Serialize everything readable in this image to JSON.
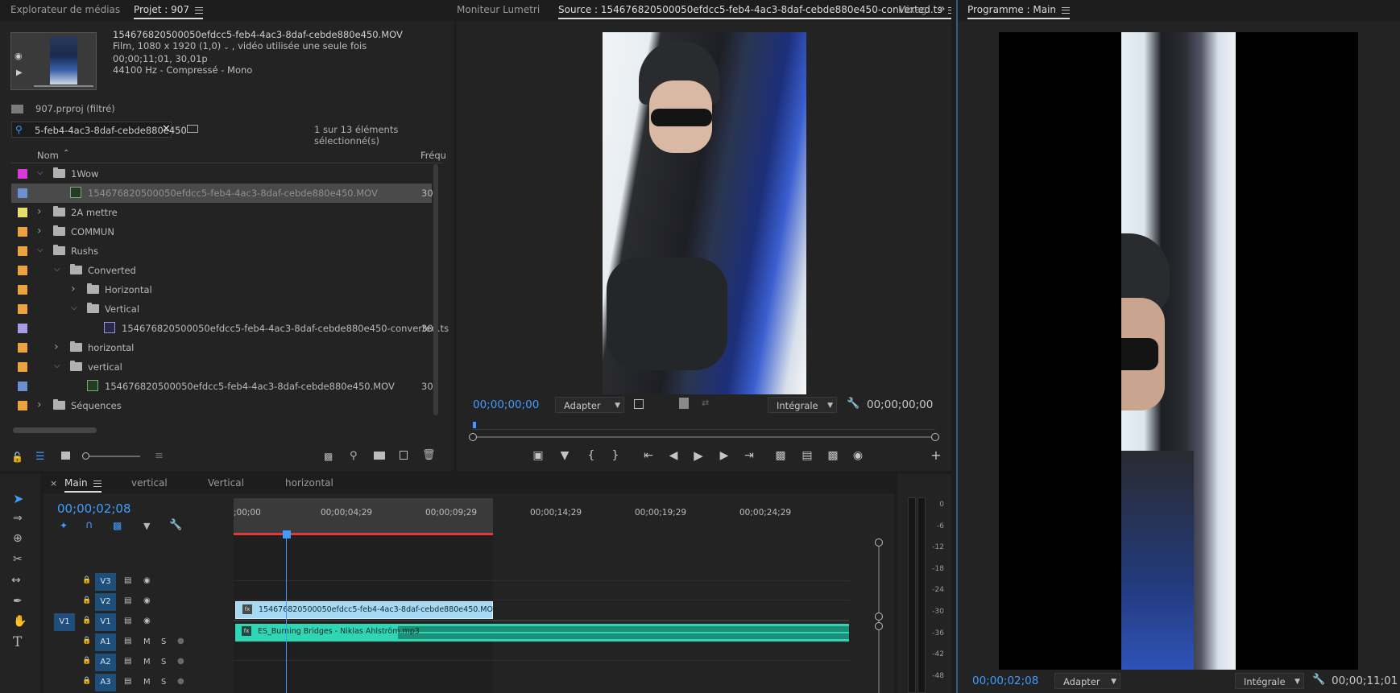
{
  "project_panel": {
    "tabs": [
      "Explorateur de médias",
      "Projet : 907"
    ],
    "clip_info": {
      "name": "154676820500050efdcc5-feb4-4ac3-8daf-cebde880e450.MOV",
      "line2": "Film, 1080 x 1920 (1,0)",
      "line2_suffix": ", vidéo utilisée une seule fois",
      "line3": "00;00;11;01, 30,01p",
      "line4": "44100 Hz - Compressé - Mono"
    },
    "project_file": "907.prproj (filtré)",
    "search_value": "5-feb4-4ac3-8daf-cebde880e450",
    "selection_count": "1 sur 13 éléments sélectionné(s)",
    "col_name": "Nom",
    "col_rate": "Fréqu",
    "rows": [
      {
        "name": "1Wow",
        "type": "folder",
        "expanded": true,
        "color": "#d63ad6",
        "rate": ""
      },
      {
        "name": "154676820500050efdcc5-feb4-4ac3-8daf-cebde880e450.MOV",
        "type": "sequence",
        "color": "#6b8fd0",
        "rate": "30,"
      },
      {
        "name": "2A mettre",
        "type": "folder",
        "expanded": false,
        "color": "#e6e06a",
        "rate": ""
      },
      {
        "name": "COMMUN",
        "type": "folder",
        "expanded": false,
        "color": "#eba240",
        "rate": ""
      },
      {
        "name": "Rushs",
        "type": "folder",
        "expanded": true,
        "color": "#eba240",
        "rate": ""
      },
      {
        "name": "Converted",
        "type": "folder",
        "expanded": true,
        "color": "#eba240",
        "rate": ""
      },
      {
        "name": "Horizontal",
        "type": "folder",
        "expanded": false,
        "color": "#eba240",
        "rate": ""
      },
      {
        "name": "Vertical",
        "type": "folder",
        "expanded": true,
        "color": "#eba240",
        "rate": ""
      },
      {
        "name": "154676820500050efdcc5-feb4-4ac3-8daf-cebde880e450-converted.ts",
        "type": "clip",
        "color": "#a89ae6",
        "rate": "30,"
      },
      {
        "name": "horizontal",
        "type": "folder",
        "expanded": false,
        "color": "#eba240",
        "rate": ""
      },
      {
        "name": "vertical",
        "type": "folder",
        "expanded": true,
        "color": "#eba240",
        "rate": ""
      },
      {
        "name": "154676820500050efdcc5-feb4-4ac3-8daf-cebde880e450.MOV",
        "type": "sequence",
        "color": "#6b8fd0",
        "rate": "30,"
      },
      {
        "name": "Séquences",
        "type": "folder",
        "expanded": false,
        "color": "#eba240",
        "rate": ""
      }
    ]
  },
  "source_panel": {
    "tabs": [
      "Moniteur Lumetri",
      "Source : 154676820500050efdcc5-feb4-4ac3-8daf-cebde880e450-converted.ts",
      "Mixag"
    ],
    "timecode_left": "00;00;00;00",
    "zoom": "Adapter",
    "quality": "Intégrale",
    "timecode_right": "00;00;00;00",
    "playhead_fraction": 0
  },
  "program_panel": {
    "title": "Programme : Main",
    "timecode_left": "00;00;02;08",
    "zoom": "Adapter",
    "quality": "Intégrale",
    "timecode_right": "00;00;11;01"
  },
  "timeline": {
    "tabs": [
      "Main",
      "vertical",
      "Vertical",
      "horizontal"
    ],
    "current_time": "00;00;02;08",
    "ruler_labels": [
      ";00;00",
      "00;00;04;29",
      "00;00;09;29",
      "00;00;14;29",
      "00;00;19;29",
      "00;00;24;29"
    ],
    "tracks": [
      {
        "name": "V3",
        "kind": "video"
      },
      {
        "name": "V2",
        "kind": "video"
      },
      {
        "name": "V1",
        "kind": "video",
        "source": "V1"
      },
      {
        "name": "A1",
        "kind": "audio",
        "mute": "M",
        "solo": "S"
      },
      {
        "name": "A2",
        "kind": "audio",
        "mute": "M",
        "solo": "S"
      },
      {
        "name": "A3",
        "kind": "audio",
        "mute": "M",
        "solo": "S"
      }
    ],
    "clips": {
      "video": "154676820500050efdcc5-feb4-4ac3-8daf-cebde880e450.MOV",
      "audio": "ES_Burning Bridges - Niklas Ahlström.mp3"
    }
  },
  "audio_meter": {
    "labels": [
      "0",
      "-6",
      "-12",
      "-18",
      "-24",
      "-30",
      "-36",
      "-42",
      "-48"
    ]
  },
  "colors": {
    "accent_blue": "#3f9cff",
    "video_clip": "#a5d8f3",
    "audio_clip": "#2fd6b4",
    "work_area": "#e03a3a"
  }
}
